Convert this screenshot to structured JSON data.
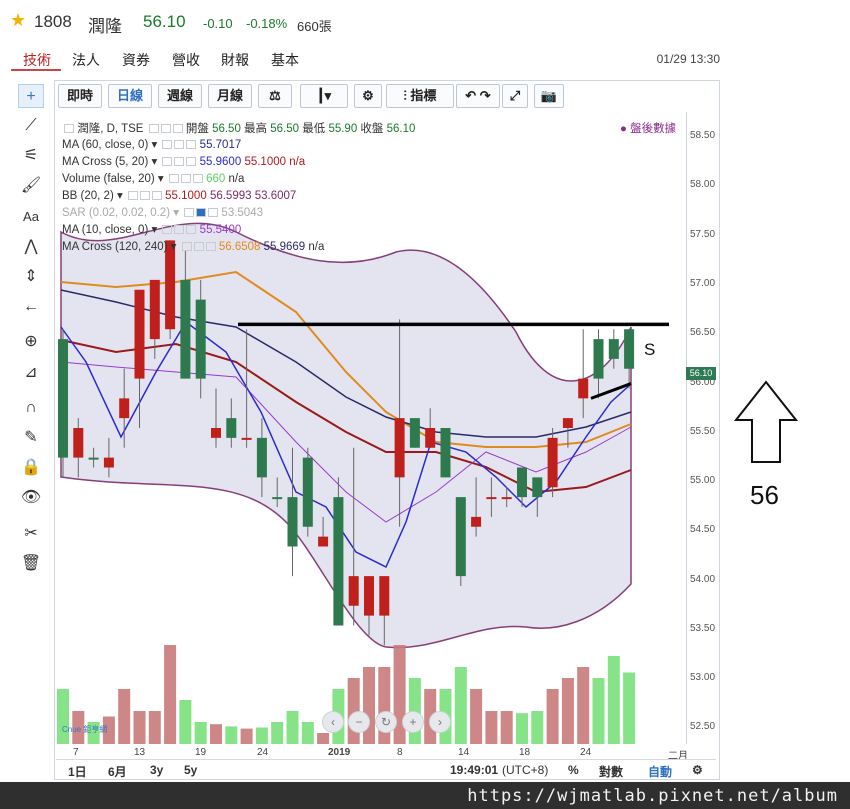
{
  "header": {
    "code": "1808",
    "name": "潤隆",
    "price": "56.10",
    "change": "-0.10",
    "change_pct": "-0.18%",
    "volume": "660張",
    "change_color": "#1a7a2a"
  },
  "tabs": [
    "技術",
    "法人",
    "資券",
    "營收",
    "財報",
    "基本"
  ],
  "active_tab": "技術",
  "datetime": "01/29 13:30",
  "left_tools": [
    "crosshair-icon",
    "trendline-icon",
    "fib-icon",
    "brush-icon",
    "text-icon",
    "pattern-icon",
    "measure-icon",
    "arrow-left-icon",
    "zoom-icon",
    "ruler-icon",
    "magnet-icon",
    "pencil-lock-icon",
    "lock-icon",
    "eye-icon",
    "tools-icon",
    "trash-icon"
  ],
  "toolbar": {
    "realtime": "即時",
    "daily": "日線",
    "weekly": "週線",
    "monthly": "月線",
    "indicators": "指標"
  },
  "legend": {
    "main": "潤隆, D, TSE",
    "open_label": "開盤",
    "open": "56.50",
    "high_label": "最高",
    "high": "56.50",
    "low_label": "最低",
    "low": "55.90",
    "close_label": "收盤",
    "close": "56.10",
    "after_hours": "盤後數據",
    "ma60_name": "MA (60, close, 0)",
    "ma60_val": "55.7017",
    "macross_name": "MA Cross (5, 20)",
    "macross_v1": "55.9600",
    "macross_v2": "55.1000",
    "macross_v3": "n/a",
    "volume_name": "Volume (false, 20)",
    "volume_v1": "660",
    "volume_v2": "n/a",
    "bb_name": "BB (20, 2)",
    "bb_v1": "55.1000",
    "bb_v2": "56.5993",
    "bb_v3": "53.6007",
    "sar_name": "SAR (0.02, 0.02, 0.2)",
    "sar_val": "53.5043",
    "ma10_name": "MA (10, close, 0)",
    "ma10_val": "55.5400",
    "macross2_name": "MA Cross (120, 240)",
    "macross2_v1": "56.6508",
    "macross2_v2": "55.9669",
    "macross2_v3": "n/a"
  },
  "y_axis": [
    "58.50",
    "58.00",
    "57.50",
    "57.00",
    "56.50",
    "56.00",
    "55.50",
    "55.00",
    "54.50",
    "54.00",
    "53.50",
    "53.00",
    "52.50"
  ],
  "price_tag": "56.10",
  "x_axis": [
    "7",
    "13",
    "19",
    "24",
    "2019",
    "8",
    "14",
    "18",
    "24",
    "二月"
  ],
  "bottom": {
    "range_1d": "1日",
    "range_6m": "6月",
    "range_3y": "3y",
    "range_5y": "5y",
    "time": "19:49:01",
    "tz": "(UTC+8)",
    "pct": "%",
    "log": "對數",
    "auto": "自動"
  },
  "annotations": {
    "s_label": "S",
    "value_56": "56"
  },
  "watermark": "https://wjmatlab.pixnet.net/album",
  "logo_text": "Cnue 鉅亨網",
  "chart_data": {
    "type": "candlestick",
    "ylim": [
      52.3,
      58.7
    ],
    "candles": [
      {
        "o": 55.2,
        "h": 56.5,
        "l": 55.0,
        "c": 56.4,
        "up": false
      },
      {
        "o": 55.5,
        "h": 55.6,
        "l": 55.0,
        "c": 55.2,
        "up": true
      },
      {
        "o": 55.2,
        "h": 55.3,
        "l": 55.1,
        "c": 55.2,
        "up": false
      },
      {
        "o": 55.1,
        "h": 55.4,
        "l": 55.0,
        "c": 55.2,
        "up": true
      },
      {
        "o": 55.6,
        "h": 56.1,
        "l": 55.3,
        "c": 55.8,
        "up": true
      },
      {
        "o": 56.0,
        "h": 56.5,
        "l": 55.5,
        "c": 56.9,
        "up": true
      },
      {
        "o": 56.4,
        "h": 57.0,
        "l": 56.2,
        "c": 57.0,
        "up": true
      },
      {
        "o": 56.5,
        "h": 57.4,
        "l": 56.4,
        "c": 57.4,
        "up": true
      },
      {
        "o": 57.0,
        "h": 57.3,
        "l": 56.0,
        "c": 56.0,
        "up": false
      },
      {
        "o": 56.8,
        "h": 57.0,
        "l": 55.8,
        "c": 56.0,
        "up": false
      },
      {
        "o": 55.5,
        "h": 55.9,
        "l": 55.3,
        "c": 55.4,
        "up": true
      },
      {
        "o": 55.6,
        "h": 55.8,
        "l": 55.3,
        "c": 55.4,
        "up": false
      },
      {
        "o": 55.4,
        "h": 56.5,
        "l": 55.3,
        "c": 55.4,
        "up": true
      },
      {
        "o": 55.4,
        "h": 55.6,
        "l": 54.8,
        "c": 55.0,
        "up": false
      },
      {
        "o": 54.8,
        "h": 55.0,
        "l": 54.7,
        "c": 54.8,
        "up": false
      },
      {
        "o": 54.8,
        "h": 55.3,
        "l": 54.0,
        "c": 54.3,
        "up": false
      },
      {
        "o": 55.2,
        "h": 55.3,
        "l": 54.4,
        "c": 54.5,
        "up": false
      },
      {
        "o": 54.4,
        "h": 54.6,
        "l": 54.3,
        "c": 54.3,
        "up": true
      },
      {
        "o": 54.8,
        "h": 55.0,
        "l": 53.5,
        "c": 53.5,
        "up": false
      },
      {
        "o": 54.0,
        "h": 55.3,
        "l": 53.5,
        "c": 53.7,
        "up": true
      },
      {
        "o": 53.6,
        "h": 54.0,
        "l": 53.4,
        "c": 54.0,
        "up": true
      },
      {
        "o": 53.6,
        "h": 54.0,
        "l": 53.3,
        "c": 54.0,
        "up": true
      },
      {
        "o": 55.0,
        "h": 56.6,
        "l": 54.5,
        "c": 55.6,
        "up": true
      },
      {
        "o": 55.6,
        "h": 55.6,
        "l": 55.3,
        "c": 55.3,
        "up": false
      },
      {
        "o": 55.3,
        "h": 55.7,
        "l": 55.3,
        "c": 55.5,
        "up": true
      },
      {
        "o": 55.5,
        "h": 55.5,
        "l": 55.0,
        "c": 55.0,
        "up": false
      },
      {
        "o": 54.8,
        "h": 54.8,
        "l": 53.9,
        "c": 54.0,
        "up": false
      },
      {
        "o": 54.5,
        "h": 55.0,
        "l": 54.4,
        "c": 54.6,
        "up": true
      },
      {
        "o": 54.8,
        "h": 55.0,
        "l": 54.6,
        "c": 54.8,
        "up": true
      },
      {
        "o": 54.8,
        "h": 54.9,
        "l": 54.7,
        "c": 54.8,
        "up": true
      },
      {
        "o": 55.1,
        "h": 55.1,
        "l": 54.7,
        "c": 54.8,
        "up": false
      },
      {
        "o": 54.8,
        "h": 55.0,
        "l": 54.6,
        "c": 55.0,
        "up": false
      },
      {
        "o": 54.9,
        "h": 55.5,
        "l": 54.8,
        "c": 55.4,
        "up": true
      },
      {
        "o": 55.5,
        "h": 55.6,
        "l": 55.3,
        "c": 55.6,
        "up": true
      },
      {
        "o": 55.8,
        "h": 56.5,
        "l": 55.6,
        "c": 56.0,
        "up": true
      },
      {
        "o": 56.0,
        "h": 56.5,
        "l": 55.8,
        "c": 56.4,
        "up": false
      },
      {
        "o": 56.4,
        "h": 56.5,
        "l": 56.1,
        "c": 56.2,
        "up": false
      },
      {
        "o": 56.5,
        "h": 56.5,
        "l": 55.9,
        "c": 56.1,
        "up": false
      }
    ]
  }
}
